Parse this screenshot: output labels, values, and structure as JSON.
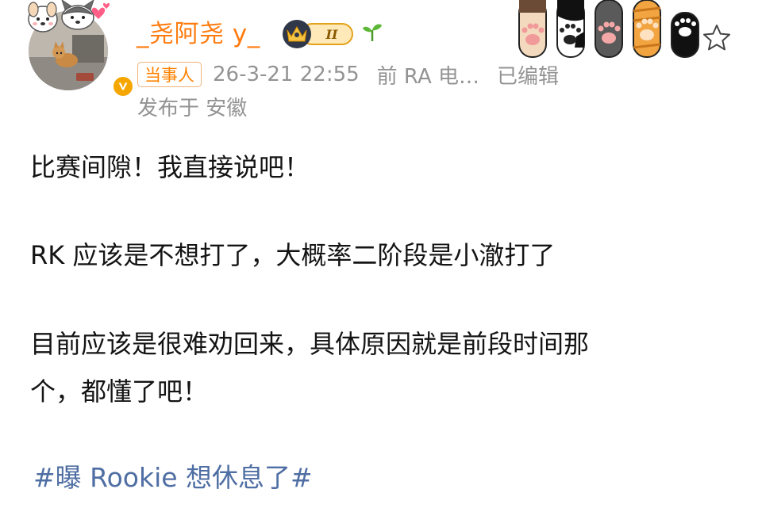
{
  "user": {
    "name": "_尧阿尧 y_",
    "vip_level": "II"
  },
  "meta": {
    "tag": "当事人",
    "timestamp": "26-3-21 22:55",
    "source": "前 RA 电…",
    "edited": "已编辑",
    "location": "发布于 安徽"
  },
  "post": {
    "line1": "比赛间隙！我直接说吧！",
    "line2": "RK 应该是不想打了，大概率二阶段是小澈打了",
    "line3a": "目前应该是很难劝回来，具体原因就是前段时间那",
    "line3b": "个，都懂了吧！",
    "hashtag": "#曝 Rookie 想休息了#"
  },
  "icons": {
    "verified": "verified-v-icon",
    "vip": "crown-vip-badge",
    "sprout": "sprout-icon",
    "star": "star-outline-icon",
    "paws": "cat-paws-decoration"
  },
  "colors": {
    "username": "#ff7b0f",
    "tag": "#ff8200",
    "meta": "#939393",
    "text": "#141414",
    "hashtag": "#4f6ea3",
    "verified": "#f6a600"
  }
}
